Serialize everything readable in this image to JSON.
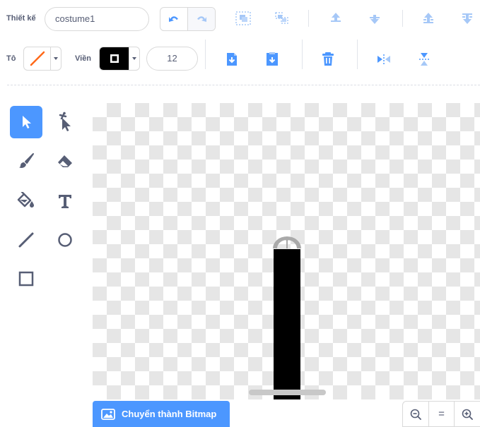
{
  "toolbar": {
    "design_label": "Thiết kế",
    "costume_name": "costume1",
    "fill_label": "Tô",
    "outline_label": "Viền",
    "outline_size": "12"
  },
  "colors": {
    "accent": "#4c97ff",
    "fill_line": "#ff6a1a",
    "outline": "#000000",
    "text": "#575e75"
  },
  "icons": {
    "undo": "undo-icon",
    "redo": "redo-icon",
    "group": "group-icon",
    "ungroup": "ungroup-icon",
    "forward": "forward-icon",
    "backward": "backward-icon",
    "front": "front-icon",
    "back": "back-icon",
    "copy": "copy-icon",
    "paste": "paste-icon",
    "delete": "trash-icon",
    "flip_h": "flip-horizontal-icon",
    "flip_v": "flip-vertical-icon"
  },
  "tools": [
    "select",
    "reshape",
    "brush",
    "eraser",
    "fill",
    "text",
    "line",
    "circle",
    "rectangle"
  ],
  "footer": {
    "convert_label": "Chuyển thành Bitmap",
    "zoom_reset_symbol": "="
  }
}
